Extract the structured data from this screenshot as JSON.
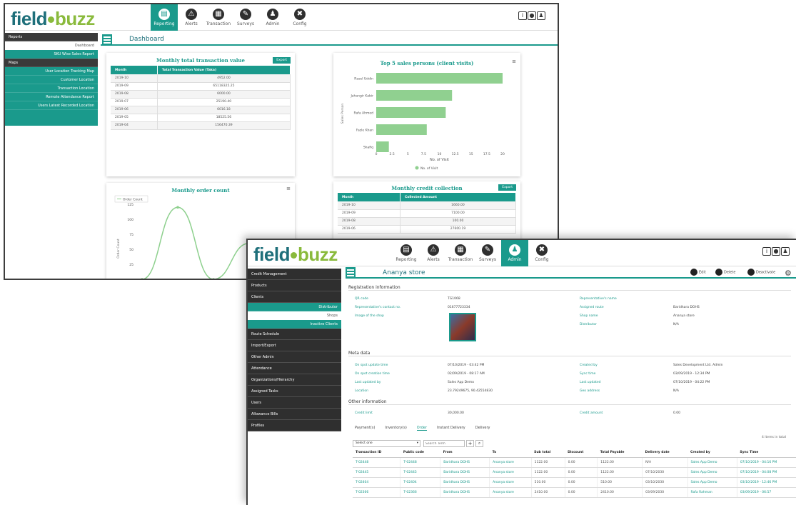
{
  "w1": {
    "logo": {
      "a": "field",
      "b": "buzz"
    },
    "nav": [
      {
        "label": "Reporting",
        "icon": "reporting-icon",
        "glyph": "▤"
      },
      {
        "label": "Alerts",
        "icon": "alert-icon",
        "glyph": "⚠"
      },
      {
        "label": "Transaction",
        "icon": "transaction-icon",
        "glyph": "▦"
      },
      {
        "label": "Surveys",
        "icon": "survey-icon",
        "glyph": "✎"
      },
      {
        "label": "Admin",
        "icon": "admin-icon",
        "glyph": "♟"
      },
      {
        "label": "Config",
        "icon": "config-icon",
        "glyph": "✖"
      }
    ],
    "sidebar": {
      "reports": "Reports",
      "dashboard": "Dashboard",
      "sku": "SKU Wise Sales Report",
      "maps": "Maps",
      "items": [
        "User Location Tracking Map",
        "Customer Location",
        "Transaction Location",
        "Remote Attendance Report",
        "Users Latest Recorded Location"
      ]
    },
    "page_title": "Dashboard",
    "tx": {
      "title": "Monthly total transaction value",
      "export": "Export",
      "headers": [
        "Month",
        "Total Transaction Value (Taka)"
      ],
      "rows": [
        [
          "2019-10",
          "4952.00"
        ],
        [
          "2019-09",
          "65118325.25"
        ],
        [
          "2019-08",
          "6000.00"
        ],
        [
          "2019-07",
          "25190.40"
        ],
        [
          "2019-06",
          "6016.18"
        ],
        [
          "2019-05",
          "18525.56"
        ],
        [
          "2019-04",
          "156470.39"
        ]
      ]
    },
    "top5": {
      "title": "Top 5 sales persons (client visits)",
      "ylabel": "Sales Person",
      "xlabel": "No. of Visit",
      "legend": "No. of Visit"
    },
    "order": {
      "title": "Monthly order count",
      "legend": "Order Count",
      "ylabel": "Order Count"
    },
    "credit": {
      "title": "Monthly credit collection",
      "export": "Export",
      "headers": [
        "Month",
        "Collected Amount"
      ],
      "rows": [
        [
          "2019-10",
          "1660.00"
        ],
        [
          "2019-09",
          "7100.00"
        ],
        [
          "2019-08",
          "100.00"
        ],
        [
          "2019-06",
          "27600.19"
        ]
      ]
    }
  },
  "w2": {
    "logo": {
      "a": "field",
      "b": "buzz"
    },
    "nav": [
      {
        "label": "Reporting",
        "icon": "reporting-icon",
        "glyph": "▤"
      },
      {
        "label": "Alerts",
        "icon": "alert-icon",
        "glyph": "⚠"
      },
      {
        "label": "Transaction",
        "icon": "transaction-icon",
        "glyph": "▦"
      },
      {
        "label": "Surveys",
        "icon": "survey-icon",
        "glyph": "✎"
      },
      {
        "label": "Admin",
        "icon": "admin-icon",
        "glyph": "♟"
      },
      {
        "label": "Config",
        "icon": "config-icon",
        "glyph": "✖"
      }
    ],
    "sidebar": {
      "credit": "Credit Management",
      "products": "Products",
      "clients": "Clients",
      "distributor": "Distributor",
      "shops": "Shops",
      "inactive": "Inactive Clients",
      "items": [
        "Route Schedule",
        "Import/Export",
        "Other Admin",
        "Attendance",
        "Organizations/Hierarchy",
        "Assigned Tasks",
        "Users",
        "Allowance Bills",
        "Profiles"
      ]
    },
    "page_title": "Ananya store",
    "actions": {
      "edit": "Edit",
      "delete": "Delete",
      "deactivate": "Deactivate"
    },
    "reg": {
      "title": "Registration information",
      "qr_l": "QR code",
      "qr_v": "TG1068",
      "rep_name_l": "Representative's name",
      "rep_contact_l": "Representative's contact no.",
      "rep_contact_v": "01677723334",
      "route_l": "Assigned route",
      "route_v": "Baridhara DOHS",
      "image_l": "Image of the shop",
      "shop_l": "Shop name",
      "shop_v": "Ananya store",
      "dist_l": "Distributor",
      "dist_v": "N/A"
    },
    "meta": {
      "title": "Meta data",
      "r1l": "On spot update time",
      "r1v": "07/10/2019 - 03:42 PM",
      "r1l2": "Created by",
      "r1v2": "Sales Development Ltd. Admin",
      "r2l": "On spot creation time",
      "r2v": "02/09/2019 - 08:17 AM",
      "r2l2": "Sync time",
      "r2v2": "03/09/2019 - 12:34 PM",
      "r3l": "Last updated by",
      "r3v": "Sales App Demo",
      "r3l2": "Last updated",
      "r3v2": "07/10/2019 - 04:22 PM",
      "r4l": "Location",
      "r4v": "23.79249675, 90.42554830",
      "r4l2": "Geo address",
      "r4v2": "N/A"
    },
    "other": {
      "title": "Other information",
      "cl_l": "Credit limit",
      "cl_v": "30,000.00",
      "ca_l": "Credit amount",
      "ca_v": "0.00"
    },
    "tabs": [
      "Payment(s)",
      "Inventory(s)",
      "Order",
      "Instant Delivery",
      "Delivery"
    ],
    "select": "Select one",
    "search_placeholder": "Search Term",
    "items_total": "4 items in total",
    "table": {
      "headers": [
        "Transaction ID",
        "Public code",
        "From",
        "To",
        "Sub total",
        "Discount",
        "Total Payable",
        "Delivery date",
        "Created by",
        "Sync Time"
      ],
      "rows": [
        [
          "T-02448",
          "T-02448",
          "Baridhara DOHS",
          "Ananya store",
          "1122.00",
          "0.00",
          "1122.00",
          "N/A",
          "Sales App Demo",
          "07/10/2019 - 04:16 PM"
        ],
        [
          "T-02445",
          "T-02445",
          "Baridhara DOHS",
          "Ananya store",
          "1122.00",
          "0.00",
          "1122.00",
          "07/10/2030",
          "Sales App Demo",
          "07/10/2019 - 04:08 PM"
        ],
        [
          "T-02404",
          "T-02404",
          "Baridhara DOHS",
          "Ananya store",
          "510.00",
          "0.00",
          "510.00",
          "03/10/2030",
          "Sales App Demo",
          "03/10/2019 - 12:46 PM"
        ],
        [
          "T-02366",
          "T-02366",
          "Baridhara DOHS",
          "Ananya store",
          "2410.00",
          "0.00",
          "2410.00",
          "03/09/2030",
          "Rafa Rahman",
          "03/09/2019 - 06:57"
        ]
      ]
    }
  },
  "chart_data": [
    {
      "type": "bar",
      "title": "Top 5 sales persons (client visits)",
      "orientation": "horizontal",
      "categories": [
        "Rasel Uddin",
        "Jahangir Kabir",
        "Rafa Ahmed",
        "Fazle Khan",
        "Shafiq"
      ],
      "series": [
        {
          "name": "No. of Visit",
          "values": [
            20,
            12,
            11,
            8,
            2
          ]
        }
      ],
      "xlabel": "No. of Visit",
      "ylabel": "Sales Person",
      "xlim": [
        0,
        20
      ],
      "xticks": [
        "0",
        "2.5",
        "5",
        "7.5",
        "10",
        "12.5",
        "15",
        "17.5",
        "20"
      ],
      "legend": "bottom"
    },
    {
      "type": "line",
      "title": "Monthly order count",
      "series": [
        {
          "name": "Order Count",
          "values": [
            0,
            120,
            0,
            60,
            0
          ]
        }
      ],
      "ylabel": "Order Count",
      "yticks": [
        "125",
        "100",
        "75",
        "50",
        "25"
      ],
      "ylim": [
        0,
        125
      ],
      "legend": "top-left"
    }
  ]
}
